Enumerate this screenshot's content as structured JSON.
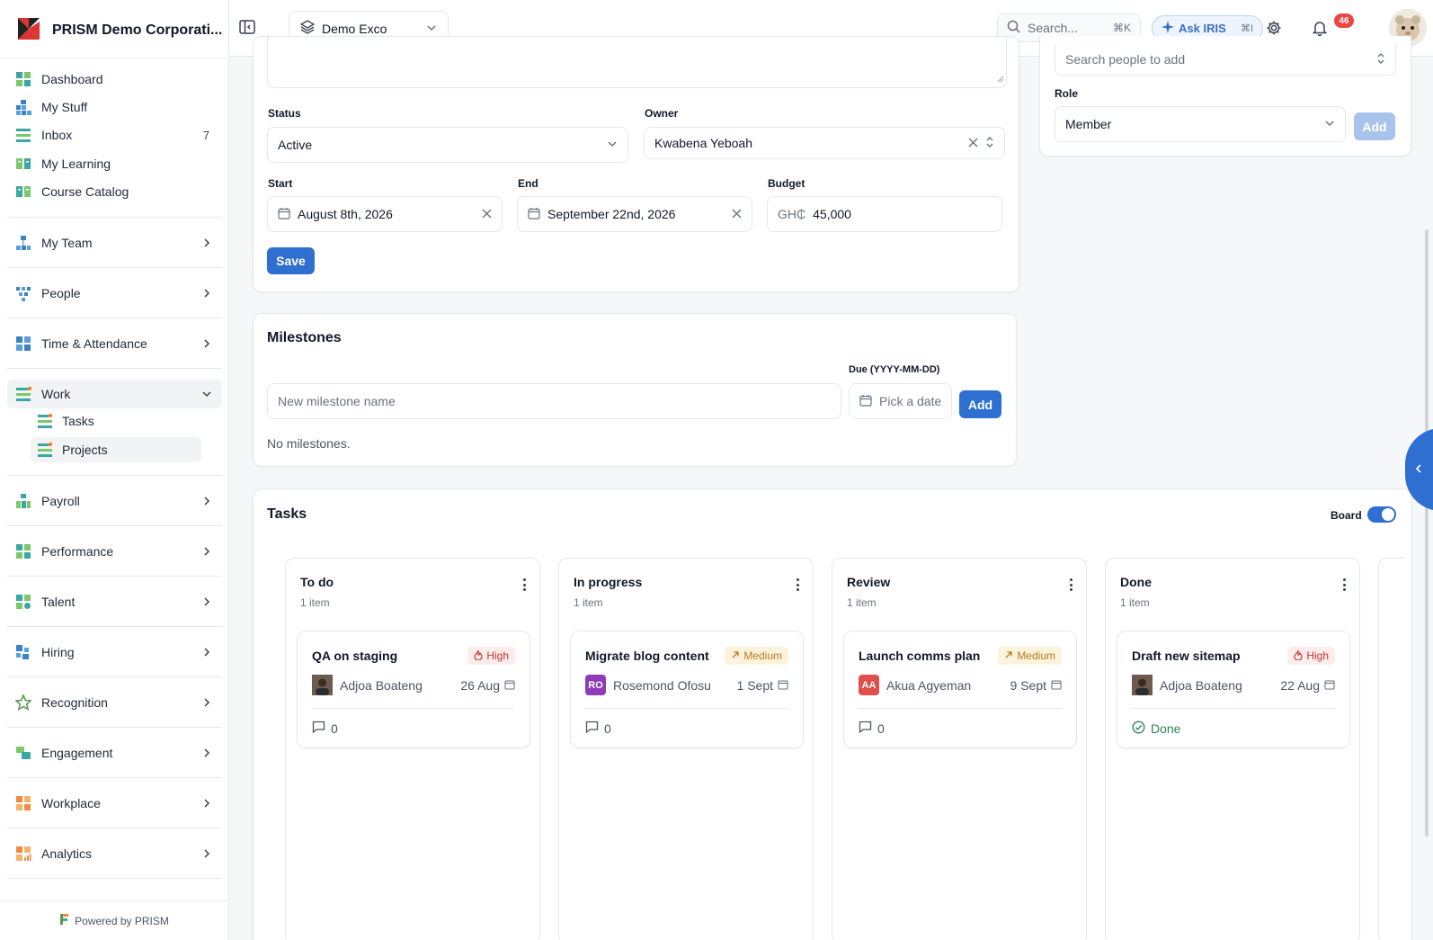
{
  "sidebar": {
    "brand": "PRISM Demo Corporati...",
    "items": [
      {
        "label": "Dashboard"
      },
      {
        "label": "My Stuff"
      },
      {
        "label": "Inbox",
        "count": "7"
      },
      {
        "label": "My Learning"
      },
      {
        "label": "Course Catalog"
      },
      {
        "label": "My Team"
      },
      {
        "label": "People"
      },
      {
        "label": "Time & Attendance"
      },
      {
        "label": "Work"
      },
      {
        "label": "Payroll"
      },
      {
        "label": "Performance"
      },
      {
        "label": "Talent"
      },
      {
        "label": "Hiring"
      },
      {
        "label": "Recognition"
      },
      {
        "label": "Engagement"
      },
      {
        "label": "Workplace"
      },
      {
        "label": "Analytics"
      }
    ],
    "work_sub": [
      {
        "label": "Tasks"
      },
      {
        "label": "Projects"
      }
    ],
    "powered_by": "Powered by PRISM"
  },
  "topbar": {
    "workspace": "Demo Exco",
    "search_placeholder": "Search...",
    "search_shortcut": "⌘K",
    "ask_label": "Ask IRIS",
    "ask_shortcut": "⌘I",
    "notification_count": "46"
  },
  "project_form": {
    "status_label": "Status",
    "status_value": "Active",
    "owner_label": "Owner",
    "owner_value": "Kwabena Yeboah",
    "start_label": "Start",
    "start_value": "August 8th, 2026",
    "end_label": "End",
    "end_value": "September 22nd, 2026",
    "budget_label": "Budget",
    "budget_currency": "GH₵",
    "budget_value": "45,000",
    "save_label": "Save"
  },
  "members_panel": {
    "search_placeholder": "Search people to add",
    "role_label": "Role",
    "role_value": "Member",
    "add_label": "Add"
  },
  "milestones": {
    "title": "Milestones",
    "due_label": "Due (YYYY-MM-DD)",
    "name_placeholder": "New milestone name",
    "date_placeholder": "Pick a date",
    "add_label": "Add",
    "empty_text": "No milestones."
  },
  "tasks": {
    "title": "Tasks",
    "board_label": "Board",
    "board_on": true,
    "columns": [
      {
        "title": "To do",
        "count": "1 item",
        "card": {
          "title": "QA on staging",
          "priority": "High",
          "assignee": "Adjoa Boateng",
          "due": "26 Aug",
          "comments": "0"
        }
      },
      {
        "title": "In progress",
        "count": "1 item",
        "card": {
          "title": "Migrate blog content",
          "priority": "Medium",
          "assignee": "Rosemond Ofosu",
          "initials": "RO",
          "due": "1 Sept",
          "comments": "0"
        }
      },
      {
        "title": "Review",
        "count": "1 item",
        "card": {
          "title": "Launch comms plan",
          "priority": "Medium",
          "assignee": "Akua Agyeman",
          "initials": "AA",
          "due": "9 Sept",
          "comments": "0"
        }
      },
      {
        "title": "Done",
        "count": "1 item",
        "card": {
          "title": "Draft new sitemap",
          "priority": "High",
          "assignee": "Adjoa Boateng",
          "due": "22 Aug",
          "status": "Done"
        }
      }
    ]
  },
  "colors": {
    "primary": "#2f6fd1",
    "high": "#c0392b",
    "medium": "#b7791f",
    "done": "#2f855a",
    "badge": "#ef4444"
  }
}
